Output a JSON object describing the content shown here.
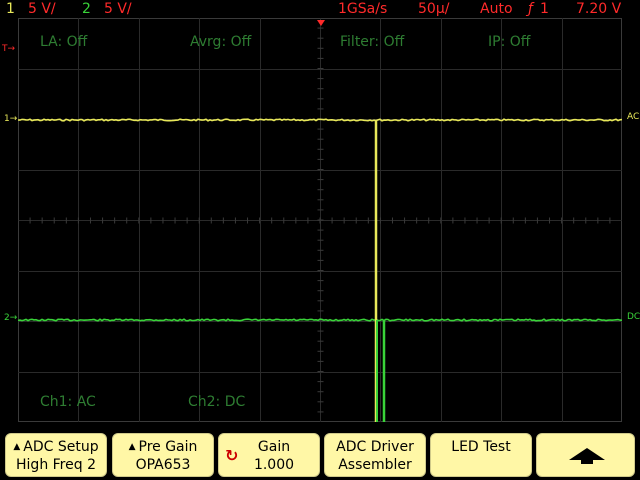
{
  "header": {
    "ch1_number": "1",
    "ch1_scale": "5 V/",
    "ch2_number": "2",
    "ch2_scale": "5 V/",
    "sample_rate": "1GSa/s",
    "timebase": "50µ/",
    "trigger_mode": "Auto",
    "trigger_icon": "trigger-edge-icon",
    "trigger_glyph": "ƒ",
    "trigger_source": "1",
    "trigger_level": "7.20 V"
  },
  "status_labels": {
    "la": "LA: Off",
    "avrg": "Avrg: Off",
    "filter": "Filter: Off",
    "ip": "IP: Off",
    "ch1_coupling": "Ch1: AC",
    "ch2_coupling": "Ch2: DC"
  },
  "markers": {
    "trigger_left": "T→",
    "ch1_left": "1→",
    "ch2_left": "2→",
    "ch1_right": "AC",
    "ch2_right": "DC"
  },
  "softkeys": [
    {
      "icon": "triangle-up-icon",
      "line1": "ADC Setup",
      "line2": "High Freq 2"
    },
    {
      "icon": "triangle-up-icon",
      "line1": "Pre Gain",
      "line2": "OPA653"
    },
    {
      "icon": "rotary-knob-icon",
      "line1": "Gain",
      "line2": "1.000"
    },
    {
      "icon": "",
      "line1": "ADC Driver",
      "line2": "Assembler"
    },
    {
      "icon": "",
      "line1": "LED Test",
      "line2": ""
    },
    {
      "icon": "arrow-up-icon",
      "line1": "",
      "line2": ""
    }
  ],
  "colors": {
    "ch1": "#e8e85a",
    "ch2": "#39d339",
    "header_red": "#ff2a2a",
    "grid": "#2a2a2a",
    "status_text": "#2e7d32",
    "softkey_bg": "#fff7a6"
  },
  "knob_glyph": "↻",
  "up_arrow_glyph": "▲"
}
